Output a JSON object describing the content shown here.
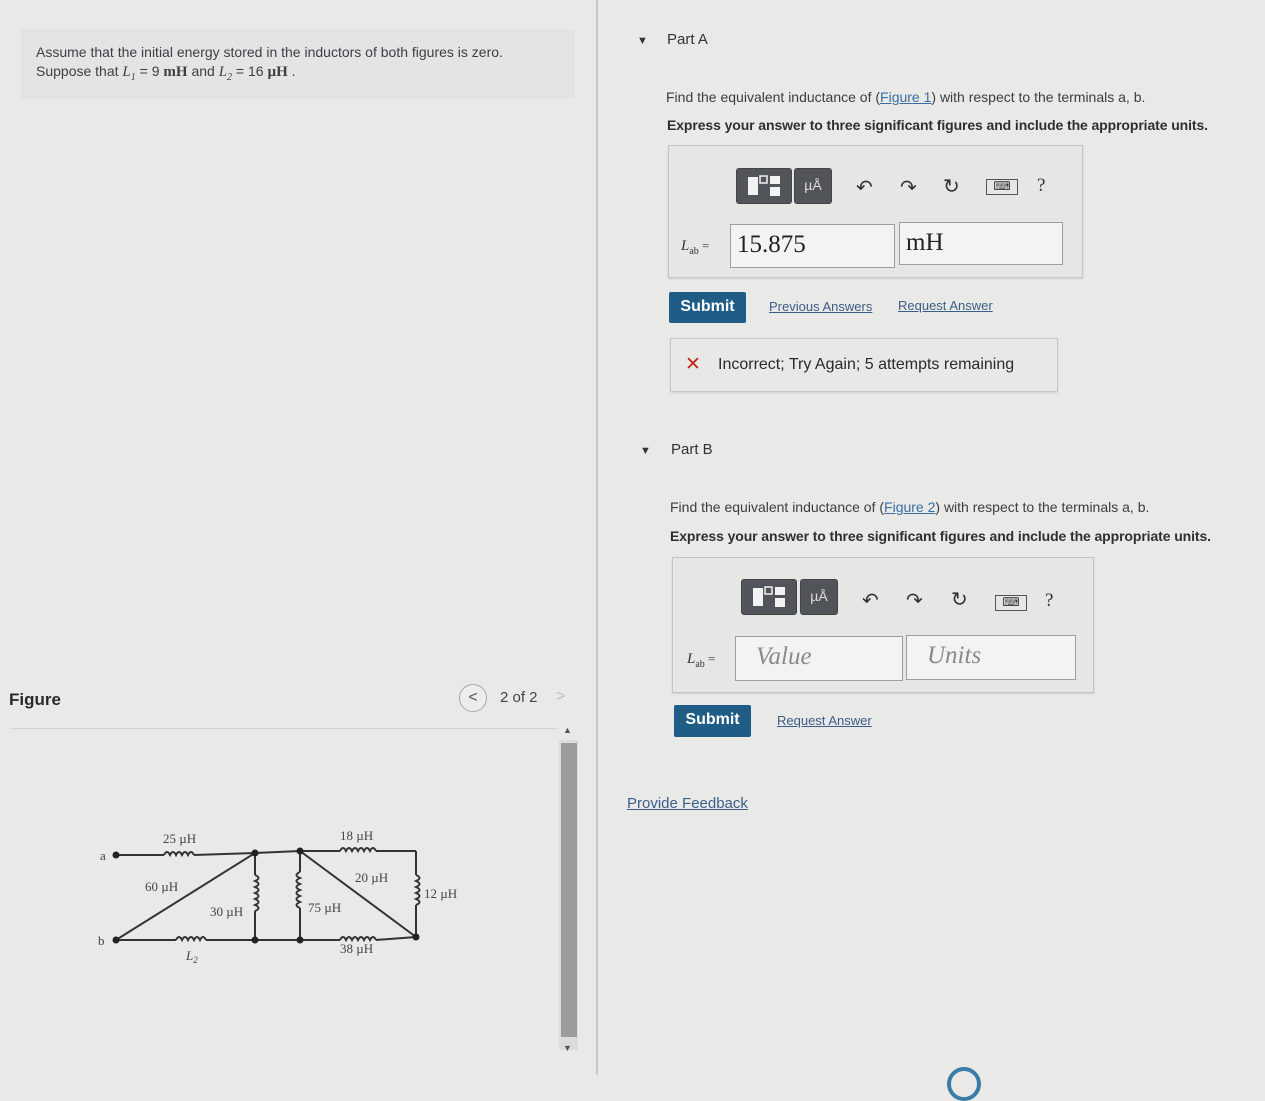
{
  "problem": {
    "line1": "Assume that the initial energy stored in the inductors of both figures is zero.",
    "line2_prefix": "Suppose that ",
    "L1_symbol": "L",
    "L1_sub": "1",
    "L1_eq": " = 9 ",
    "L1_unit": "mH",
    "and_text": " and ",
    "L2_symbol": "L",
    "L2_sub": "2",
    "L2_eq": " = 16 ",
    "L2_unit": "µH",
    "suffix": " ."
  },
  "figure_panel": {
    "label": "Figure",
    "pager_prev": "<",
    "pager_count": "2 of 2",
    "pager_next": ">",
    "scroll_up": "▲",
    "scroll_down": "▼"
  },
  "circuit": {
    "terminal_a": "a",
    "terminal_b": "b",
    "l_25": "25 µH",
    "l_60": "60 µH",
    "l_30": "30 µH",
    "l_L2": "L",
    "l_L2_sub": "2",
    "l_75": "75 µH",
    "l_18": "18 µH",
    "l_20": "20 µH",
    "l_38": "38 µH",
    "l_12": "12 µH"
  },
  "partA": {
    "caret": "▼",
    "title": "Part A",
    "question_prefix": "Find the equivalent inductance of (",
    "question_link": "Figure 1",
    "question_suffix": ") with respect to the terminals a, b.",
    "instruction": "Express your answer to three significant figures and include the appropriate units.",
    "toolbar_units_label": "µÅ",
    "toolbar_help": "?",
    "lab_label": "L",
    "lab_sub": "ab",
    "lab_eq": " =",
    "value": "15.875",
    "units": "mH",
    "submit": "Submit",
    "previous_answers": "Previous Answers",
    "request_answer": "Request Answer",
    "feedback_icon": "✕",
    "feedback_text": "Incorrect; Try Again; 5 attempts remaining"
  },
  "partB": {
    "caret": "▼",
    "title": "Part B",
    "question_prefix": "Find the equivalent inductance of (",
    "question_link": "Figure 2",
    "question_suffix": ") with respect to the terminals a, b.",
    "instruction": "Express your answer to three significant figures and include the appropriate units.",
    "toolbar_units_label": "µÅ",
    "toolbar_help": "?",
    "lab_label": "L",
    "lab_sub": "ab",
    "lab_eq": " =",
    "value_placeholder": "Value",
    "units_placeholder": "Units",
    "submit": "Submit",
    "request_answer": "Request Answer"
  },
  "footer": {
    "provide_feedback": "Provide Feedback"
  },
  "icons": [
    "templates-icon",
    "units-icon",
    "undo-icon",
    "redo-icon",
    "reset-icon",
    "keyboard-icon",
    "help-icon",
    "incorrect-icon",
    "caret-down-icon",
    "chevron-left-icon",
    "chevron-right-icon"
  ]
}
